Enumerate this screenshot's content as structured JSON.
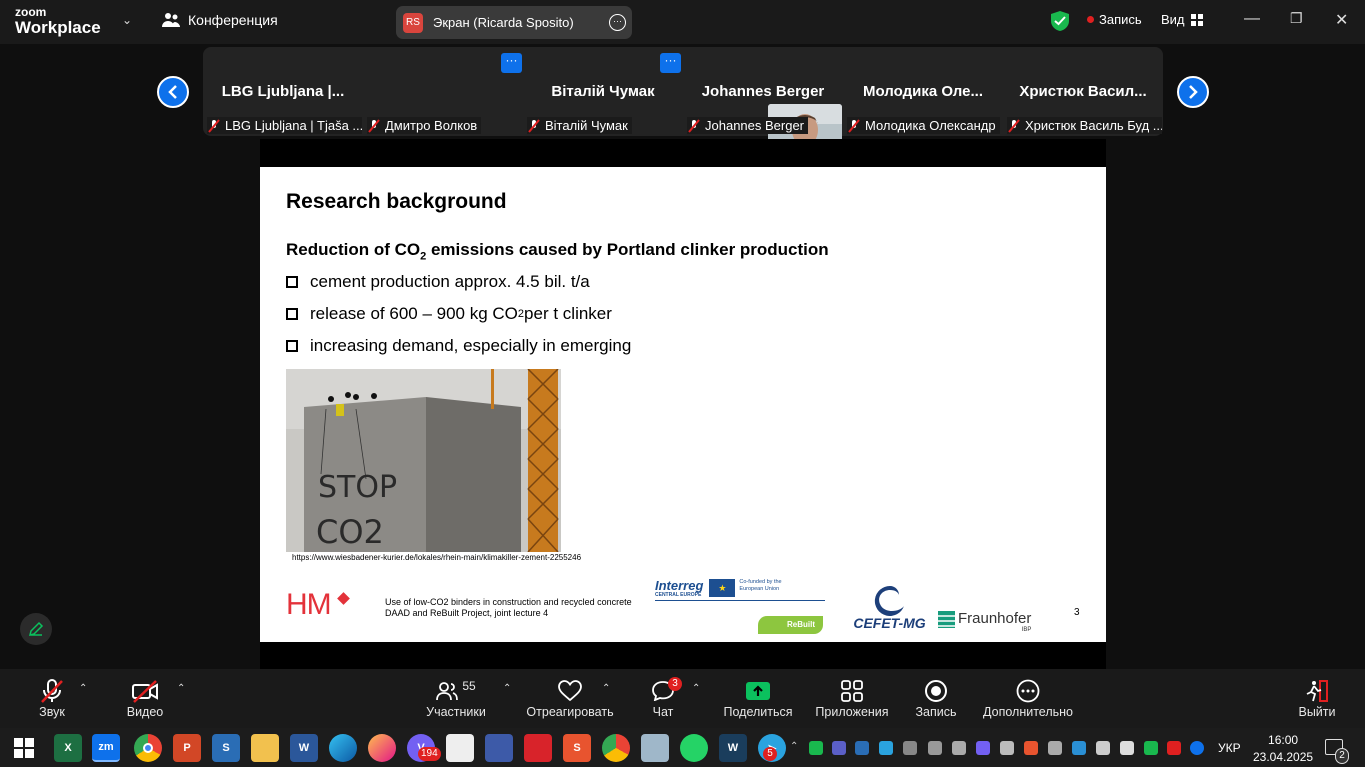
{
  "app": {
    "brand_line1": "zoom",
    "brand_line2": "Workplace",
    "meeting_label": "Конференция"
  },
  "screen_share": {
    "initials": "RS",
    "label": "Экран (Ricarda Sposito)"
  },
  "top_right": {
    "recording_label": "Запись",
    "view_label": "Вид"
  },
  "participants": [
    {
      "big": "LBG  Ljubljana |...",
      "label": "LBG Ljubljana | Tjaša ..."
    },
    {
      "big": "",
      "label": "Дмитро Волков"
    },
    {
      "big": "Віталій Чумак",
      "label": "Віталій Чумак"
    },
    {
      "big": "Johannes Berger",
      "label": "Johannes Berger"
    },
    {
      "big": "Молодика  Оле...",
      "label": "Молодика Олександр"
    },
    {
      "big": "Христюк  Васил...",
      "label": "Христюк Василь Буд ..."
    }
  ],
  "slide": {
    "title": "Research background",
    "heading_pre": "Reduction of CO",
    "heading_sub": "2",
    "heading_post": " emissions caused by Portland clinker production",
    "bullet1": "cement production approx. 4.5 bil. t/a",
    "bullet2_pre": "release of 600 – 900 kg CO",
    "bullet2_sub": "2",
    "bullet2_post": " per t clinker",
    "bullet3": "increasing demand, especially in emerging",
    "photo_text1": "STOP",
    "photo_text2": "CO2",
    "source": "https://www.wiesbadener-kurier.de/lokales/rhein-main/klimakiller-zement-2255246",
    "footer_line1": "Use of low-CO2 binders in construction and recycled concrete",
    "footer_line2": "DAAD and ReBuilt Project, joint lecture 4",
    "page_number": "3",
    "logo_hm": "HM",
    "logo_interreg": "Interreg",
    "logo_interreg_sub": "CENTRAL EUROPE",
    "logo_eu": "Co-funded by the European Union",
    "logo_rebuilt": "ReBuilt",
    "logo_cefet": "CEFET-MG",
    "logo_fraunhofer": "Fraunhofer",
    "logo_ibp": "IBP"
  },
  "toolbar": {
    "audio": "Звук",
    "video": "Видео",
    "participants": "Участники",
    "participants_count": "55",
    "react": "Отреагировать",
    "chat": "Чат",
    "chat_badge": "3",
    "share": "Поделиться",
    "apps": "Приложения",
    "record": "Запись",
    "more": "Дополнительно",
    "leave": "Выйти"
  },
  "taskbar": {
    "viber_badge": "194",
    "telegram_badge": "5",
    "lang": "УКР",
    "time": "16:00",
    "date": "23.04.2025",
    "notif_count": "2"
  },
  "colors": {
    "zoom_blue": "#0e71eb",
    "share_green": "#0bc15e",
    "hm_red": "#e3323a",
    "badge_red": "#e02020"
  }
}
